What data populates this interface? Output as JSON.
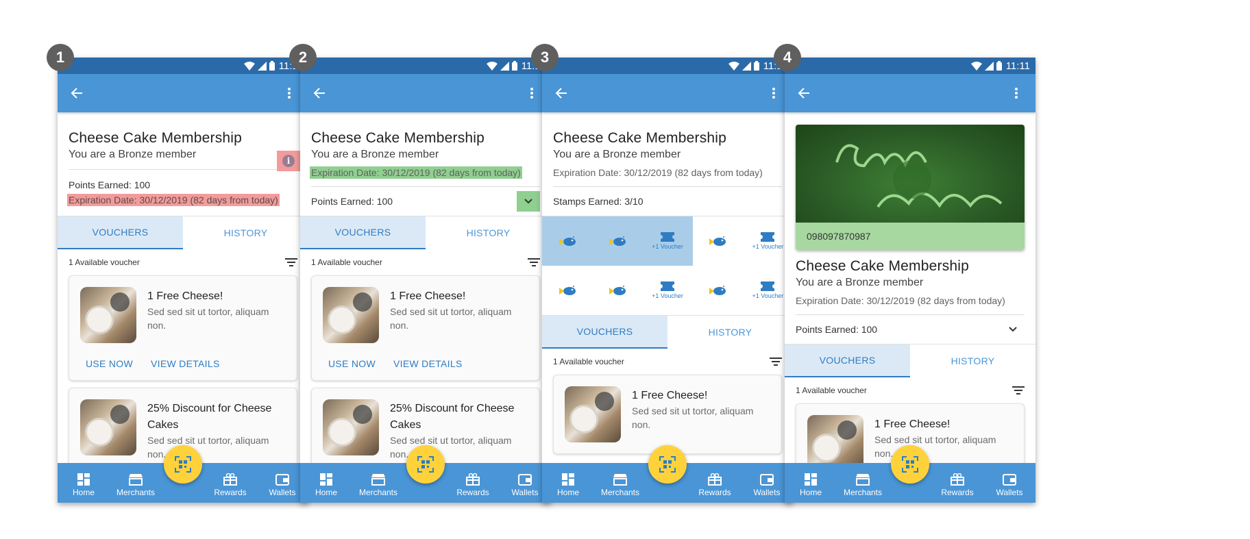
{
  "status": {
    "time": "11:11"
  },
  "steps": [
    "1",
    "2",
    "3",
    "4"
  ],
  "membership": {
    "title": "Cheese Cake Membership",
    "subtitle": "You are a Bronze member",
    "expiration": "Expiration Date: 30/12/2019 (82 days from today)",
    "points": "Points Earned: 100",
    "stamps": "Stamps Earned: 3/10",
    "card_code": "098097870987"
  },
  "tabs": {
    "vouchers": "VOUCHERS",
    "history": "HISTORY"
  },
  "voucher_count": "1 Available voucher",
  "vouchers": [
    {
      "title": "1 Free Cheese!",
      "desc": "Sed sed sit ut tortor, aliquam non.",
      "use": "USE NOW",
      "details": "VIEW DETAILS"
    },
    {
      "title": "25% Discount for Cheese Cakes",
      "desc": "Sed sed sit ut tortor, aliquam non."
    }
  ],
  "stamp_bonus_label": "+1 Voucher",
  "nav": {
    "home": "Home",
    "merchants": "Merchants",
    "rewards": "Rewards",
    "wallets": "Wallets"
  },
  "colors": {
    "primary": "#4a95d6",
    "statusbar": "#2b6aa8",
    "fab": "#ffd23c",
    "highlight_red": "#f29b9b",
    "highlight_green": "#8fcf8f"
  },
  "icons": [
    "wifi-icon",
    "signal-icon",
    "battery-icon",
    "back-arrow-icon",
    "more-vert-icon",
    "info-icon",
    "chevron-down-icon",
    "filter-icon",
    "fish-stamp-icon",
    "ticket-icon",
    "home-icon",
    "store-icon",
    "gift-icon",
    "wallet-icon",
    "qr-scan-icon"
  ]
}
